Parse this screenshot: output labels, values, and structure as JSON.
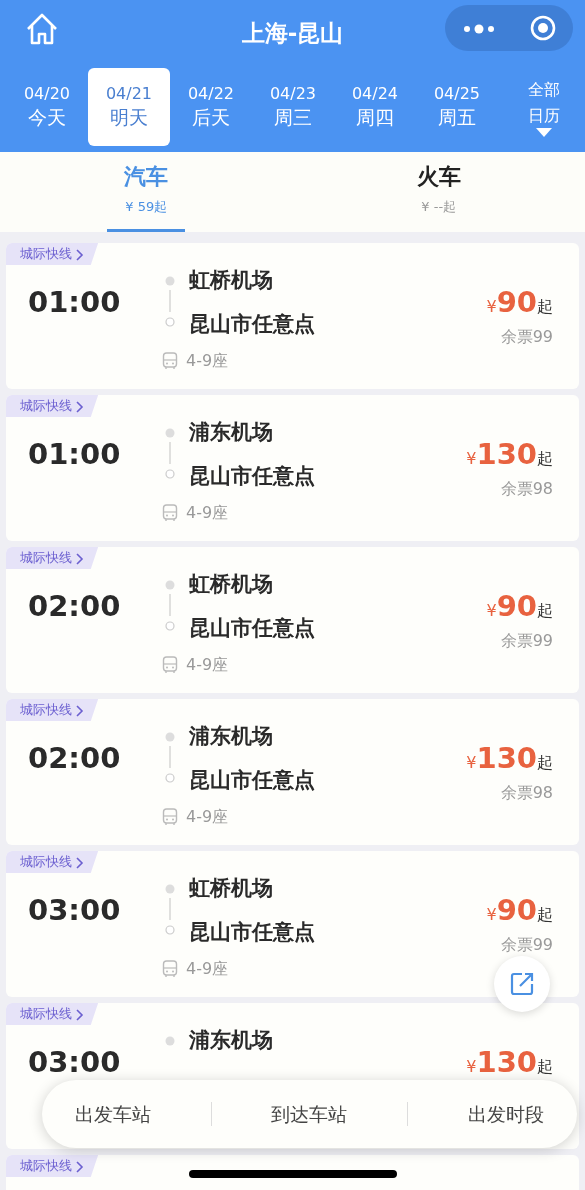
{
  "header": {
    "title": "上海-昆山"
  },
  "dates": [
    {
      "date": "04/20",
      "day": "今天",
      "selected": false
    },
    {
      "date": "04/21",
      "day": "明天",
      "selected": true
    },
    {
      "date": "04/22",
      "day": "后天",
      "selected": false
    },
    {
      "date": "04/23",
      "day": "周三",
      "selected": false
    },
    {
      "date": "04/24",
      "day": "周四",
      "selected": false
    },
    {
      "date": "04/25",
      "day": "周五",
      "selected": false
    }
  ],
  "calendar_button": {
    "line_1": "全部",
    "line_2": "日历"
  },
  "tabs": [
    {
      "label": "汽车",
      "price": "¥ 59起",
      "selected": true
    },
    {
      "label": "火车",
      "price": "¥ --起",
      "selected": false
    }
  ],
  "trips": [
    {
      "tag": "城际快线",
      "time": "01:00",
      "from": "虹桥机场",
      "to": "昆山市任意点",
      "seats": "4-9座",
      "currency": "¥",
      "amount": "90",
      "suffix": "起",
      "remaining": "余票99"
    },
    {
      "tag": "城际快线",
      "time": "01:00",
      "from": "浦东机场",
      "to": "昆山市任意点",
      "seats": "4-9座",
      "currency": "¥",
      "amount": "130",
      "suffix": "起",
      "remaining": "余票98"
    },
    {
      "tag": "城际快线",
      "time": "02:00",
      "from": "虹桥机场",
      "to": "昆山市任意点",
      "seats": "4-9座",
      "currency": "¥",
      "amount": "90",
      "suffix": "起",
      "remaining": "余票99"
    },
    {
      "tag": "城际快线",
      "time": "02:00",
      "from": "浦东机场",
      "to": "昆山市任意点",
      "seats": "4-9座",
      "currency": "¥",
      "amount": "130",
      "suffix": "起",
      "remaining": "余票98"
    },
    {
      "tag": "城际快线",
      "time": "03:00",
      "from": "虹桥机场",
      "to": "昆山市任意点",
      "seats": "4-9座",
      "currency": "¥",
      "amount": "90",
      "suffix": "起",
      "remaining": "余票99"
    },
    {
      "tag": "城际快线",
      "time": "03:00",
      "from": "浦东机场",
      "currency": "¥",
      "amount": "130",
      "suffix": "起"
    },
    {
      "tag": "城际快线"
    }
  ],
  "filter_bar": [
    "出发车站",
    "到达车站",
    "出发时段"
  ]
}
